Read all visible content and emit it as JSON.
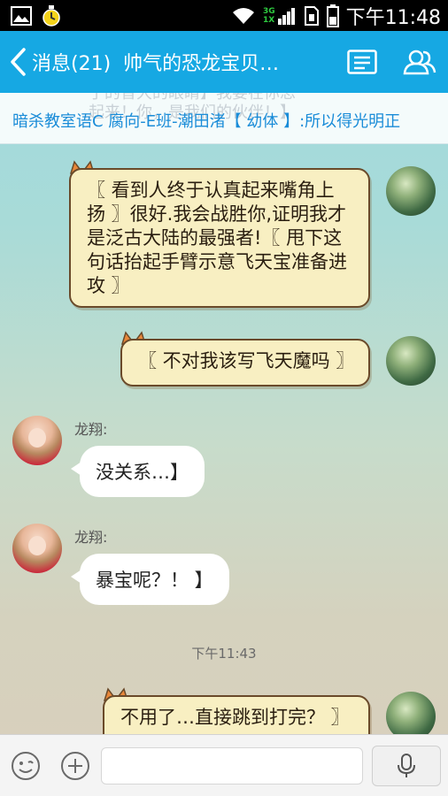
{
  "status_bar": {
    "time": "下午11:48",
    "network_3g": "3G",
    "network_1x": "1X"
  },
  "header": {
    "back_label": "消息(21)",
    "title": "帅气的恐龙宝贝…"
  },
  "pinned": {
    "ghost_text": "了的音大的眼睛】我要在你思\n起来！你，是我们的伙伴！】",
    "text": "暗杀教室语C 腐向-E班-潮田渚【 幼体 】:所以得光明正"
  },
  "messages": [
    {
      "side": "right",
      "text": "〖 看到人终于认真起来嘴角上扬 〗很好.我会战胜你,证明我才是泛古大陆的最强者!〖 甩下这句话抬起手臂示意飞天宝准备进攻 〗"
    },
    {
      "side": "right",
      "text": "〖 不对我该写飞天魔吗 〗"
    },
    {
      "side": "left",
      "sender": "龙翔:",
      "text": "没关系…】"
    },
    {
      "side": "left",
      "sender": "龙翔:",
      "text": "暴宝呢？！ 】"
    },
    {
      "side": "right",
      "text": "不用了…直接跳到打完？ 〗"
    }
  ],
  "timestamp": "下午11:43",
  "colors": {
    "header_bg": "#16a8e3",
    "pinned_text": "#1a8cd8",
    "scroll_bubble_bg": "#f8efc2"
  },
  "icons": {
    "menu": "menu-icon",
    "members": "members-icon",
    "emoji": "emoji-icon",
    "plus": "plus-icon",
    "mic": "mic-icon"
  }
}
